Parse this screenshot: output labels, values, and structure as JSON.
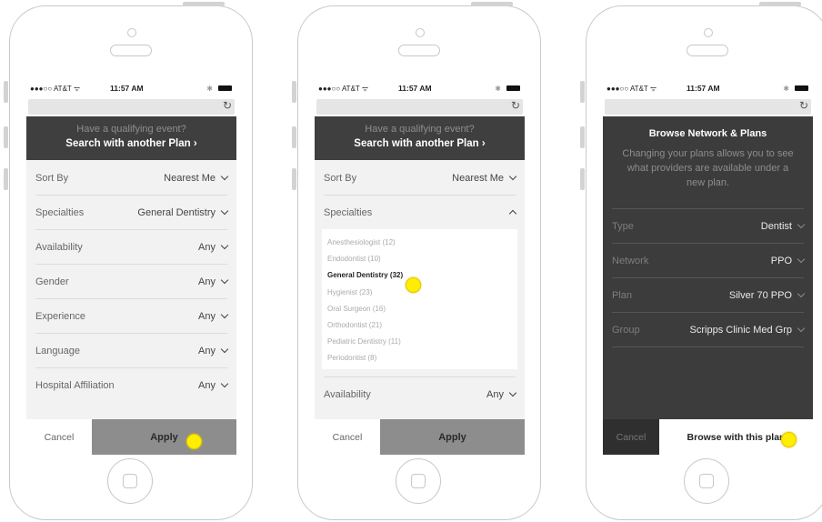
{
  "status": {
    "carrier": "●●●○○ AT&T ᯤ",
    "time": "11:57 AM",
    "bluetooth": "✱"
  },
  "banner": {
    "line1": "Have a qualifying event?",
    "line2": "Search with another Plan ›"
  },
  "filters": [
    {
      "label": "Sort By",
      "value": "Nearest Me"
    },
    {
      "label": "Specialties",
      "value": "General Dentistry"
    },
    {
      "label": "Availability",
      "value": "Any"
    },
    {
      "label": "Gender",
      "value": "Any"
    },
    {
      "label": "Experience",
      "value": "Any"
    },
    {
      "label": "Language",
      "value": "Any"
    },
    {
      "label": "Hospital Affiliation",
      "value": "Any"
    }
  ],
  "footer": {
    "cancel": "Cancel",
    "apply": "Apply"
  },
  "specialties_panel": {
    "sort_label": "Sort By",
    "sort_value": "Nearest Me",
    "header": "Specialties",
    "options": [
      "Anesthesiologist (12)",
      "Endodontist (10)",
      "General Dentistry (32)",
      "Hygienist (23)",
      "Oral Surgeon (16)",
      "Orthodontist (21)",
      "Pediatric Dentistry (11)",
      "Periodontist (8)"
    ],
    "selected_index": 2,
    "availability_label": "Availability",
    "availability_value": "Any"
  },
  "browse_panel": {
    "title": "Browse Network & Plans",
    "description": "Changing your plans allows you to see what providers are available under a new plan.",
    "fields": [
      {
        "label": "Type",
        "value": "Dentist"
      },
      {
        "label": "Network",
        "value": "PPO"
      },
      {
        "label": "Plan",
        "value": "Silver 70 PPO"
      },
      {
        "label": "Group",
        "value": "Scripps Clinic Med Grp"
      }
    ],
    "cancel": "Cancel",
    "browse": "Browse with this plan"
  },
  "colors": {
    "highlight": "#ffee00",
    "banner": "#3f3f3f",
    "apply": "#8d8d8d"
  }
}
